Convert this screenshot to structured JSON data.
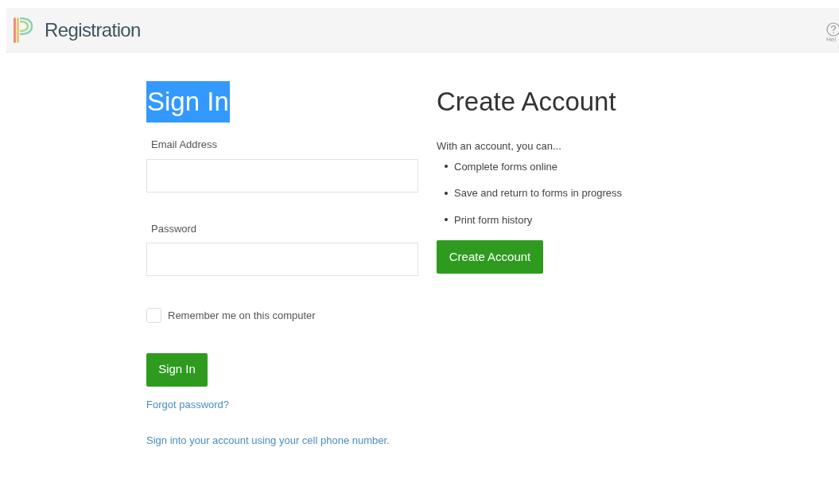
{
  "header": {
    "title": "Registration",
    "help_label": "Hel"
  },
  "sign_in": {
    "heading": "Sign In",
    "heading_highlighted": true,
    "fields": [
      {
        "label": "Email Address"
      },
      {
        "label": "Password"
      }
    ],
    "remember": {
      "label": "Remember me on this computer",
      "checked": false
    },
    "button": "Sign In",
    "links": [
      "Forgot password?",
      "Sign into your account using your cell phone number."
    ]
  },
  "create_account": {
    "heading": "Create Account",
    "intro": "With an account, you can...",
    "benefits": [
      "Complete forms online",
      "Save and return to forms in progress",
      "Print form history"
    ],
    "button": "Create Account"
  }
}
